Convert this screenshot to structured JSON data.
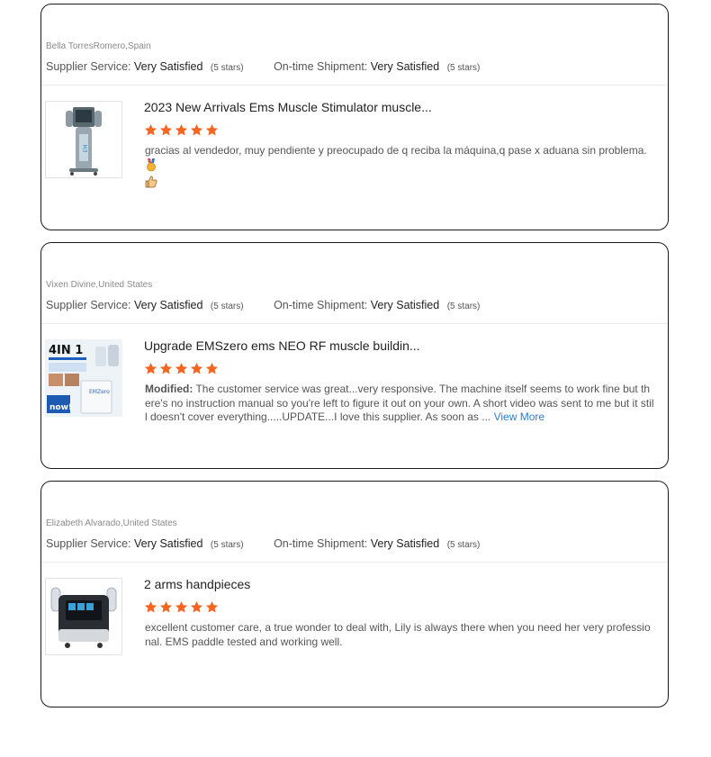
{
  "reviews": [
    {
      "reviewer": "Bella TorresRomero,Spain",
      "supplier_label": "Supplier Service:",
      "supplier_value": "Very Satisfied",
      "supplier_stars": "(5 stars)",
      "shipment_label": "On-time Shipment:",
      "shipment_value": "Very Satisfied",
      "shipment_stars": "(5 stars)",
      "product_title": "2023 New Arrivals Ems Muscle Stimulator muscle...",
      "rating": 5,
      "prefix": "",
      "body": "gracias al vendedor, muy pendiente y preocupado de q reciba la máquina,q pase x aduana sin problema.",
      "more": ""
    },
    {
      "reviewer": "Vixen Divine,United States",
      "supplier_label": "Supplier Service:",
      "supplier_value": "Very Satisfied",
      "supplier_stars": "(5 stars)",
      "shipment_label": "On-time Shipment:",
      "shipment_value": "Very Satisfied",
      "shipment_stars": "(5 stars)",
      "product_title": "Upgrade EMSzero ems NEO RF muscle buildin...",
      "rating": 5,
      "prefix": "Modified:",
      "body": " The customer service was great...very responsive. The machine itself seems to work fine but there's no instruction manual so you're left to figure it out on your own. A short video was sent to me but it still doesn't cover everything.....UPDATE...I love this supplier. As soon as ... ",
      "more": "View More",
      "thumb_text": {
        "top": "4IN 1",
        "mid": "EMZero",
        "bottom": "now!"
      }
    },
    {
      "reviewer": "Elizabeth Alvarado,United States",
      "supplier_label": "Supplier Service:",
      "supplier_value": "Very Satisfied",
      "supplier_stars": "(5 stars)",
      "shipment_label": "On-time Shipment:",
      "shipment_value": "Very Satisfied",
      "shipment_stars": "(5 stars)",
      "product_title": "2 arms handpieces",
      "rating": 5,
      "prefix": "",
      "body": "excellent customer care, a true wonder to deal with, Lily is always there when you need her very professional. EMS paddle tested and working well.",
      "more": ""
    }
  ],
  "colors": {
    "star": "#f26622",
    "link": "#2a7fd4",
    "border": "#1a1a1a"
  },
  "icons": [
    "star-icon",
    "medal-icon",
    "thumbs-up-icon"
  ]
}
